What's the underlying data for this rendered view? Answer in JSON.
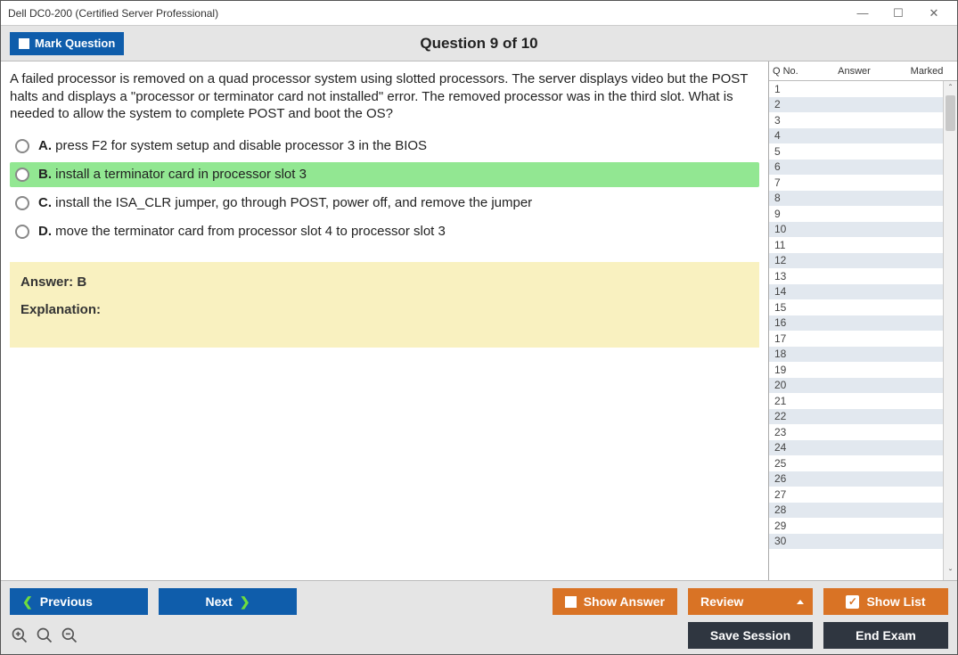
{
  "window": {
    "title": "Dell DC0-200 (Certified Server Professional)"
  },
  "header": {
    "mark_label": "Mark Question",
    "question_title": "Question 9 of 10"
  },
  "question": {
    "text": "A failed processor is removed on a quad processor system using slotted processors. The server displays video but the POST halts and displays a \"processor or terminator card not installed\" error. The removed processor was in the third slot. What is needed to allow the system to complete POST and boot the OS?",
    "options": [
      {
        "letter": "A.",
        "text": "press F2 for system setup and disable processor 3 in the BIOS",
        "correct": false
      },
      {
        "letter": "B.",
        "text": "install a terminator card in processor slot 3",
        "correct": true
      },
      {
        "letter": "C.",
        "text": "install the ISA_CLR jumper, go through POST, power off, and remove the jumper",
        "correct": false
      },
      {
        "letter": "D.",
        "text": "move the terminator card from processor slot 4 to processor slot 3",
        "correct": false
      }
    ],
    "answer_label": "Answer: B",
    "explanation_label": "Explanation:"
  },
  "side": {
    "col_qno": "Q No.",
    "col_answer": "Answer",
    "col_marked": "Marked",
    "rows": [
      1,
      2,
      3,
      4,
      5,
      6,
      7,
      8,
      9,
      10,
      11,
      12,
      13,
      14,
      15,
      16,
      17,
      18,
      19,
      20,
      21,
      22,
      23,
      24,
      25,
      26,
      27,
      28,
      29,
      30
    ]
  },
  "footer": {
    "previous": "Previous",
    "next": "Next",
    "show_answer": "Show Answer",
    "review": "Review",
    "show_list": "Show List",
    "save_session": "Save Session",
    "end_exam": "End Exam"
  }
}
